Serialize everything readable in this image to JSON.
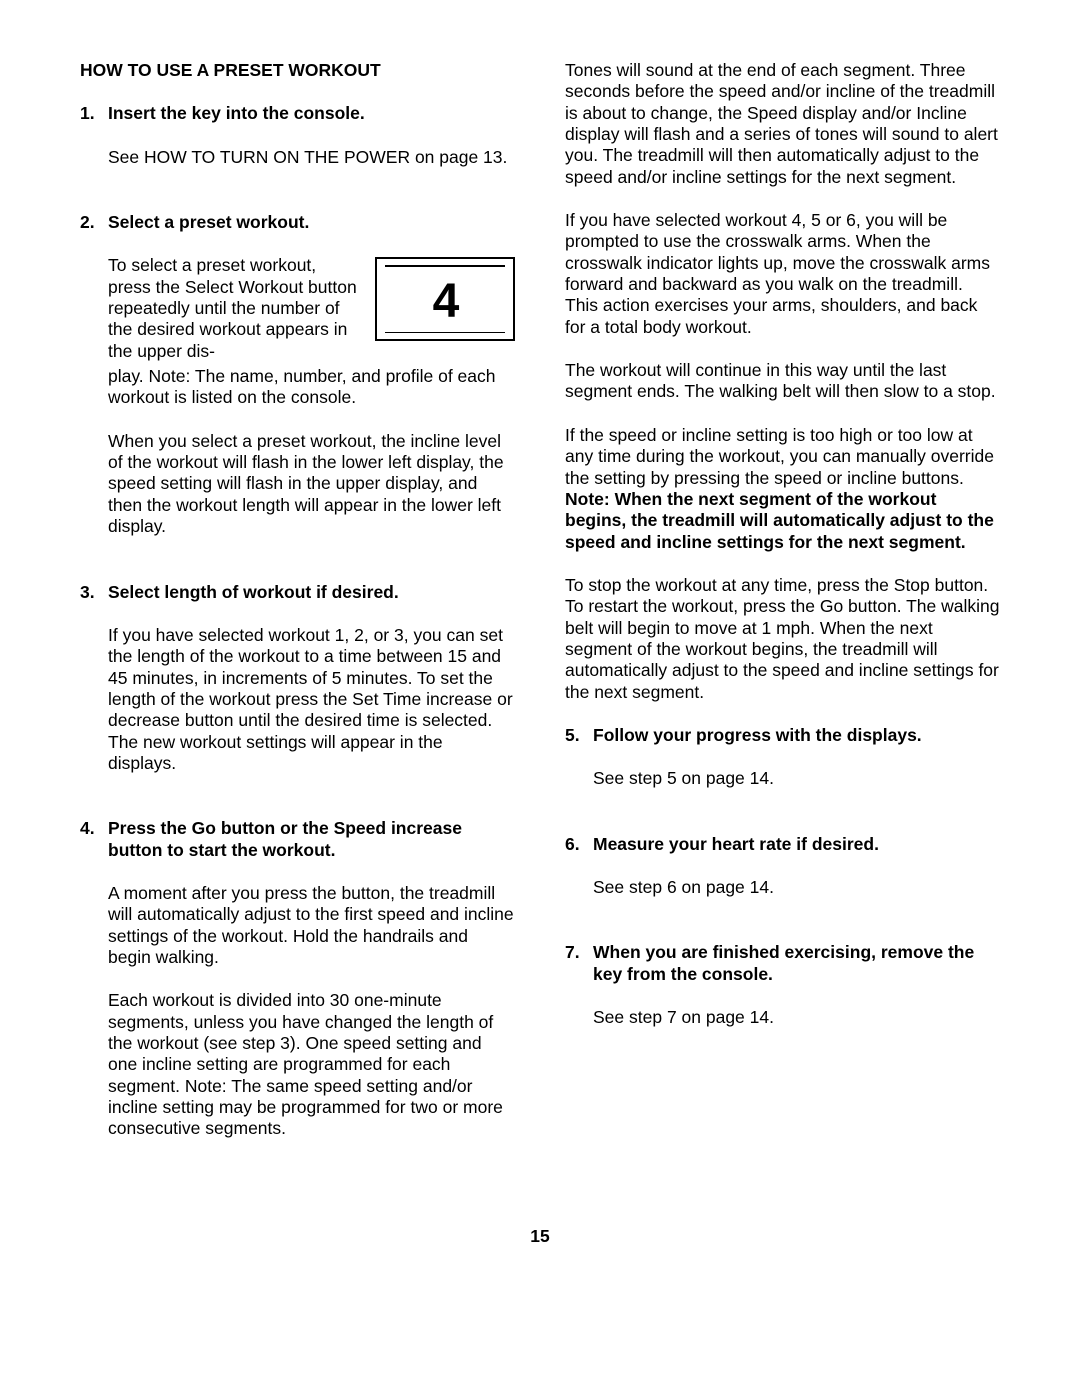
{
  "title": "HOW TO USE A PRESET WORKOUT",
  "steps_left": [
    {
      "num": "1.",
      "heading": "Insert the key into the console.",
      "paras": [
        "See HOW TO TURN ON THE POWER on page 13."
      ]
    },
    {
      "num": "2.",
      "heading": "Select a preset workout.",
      "float_text": "To select a preset workout, press the Select Workout button repeatedly until the number of the desired workout appears in the upper dis-",
      "display_digit": "4",
      "continuation": "play. Note: The name, number, and profile of each workout is listed on the console.",
      "paras": [
        "When you select a preset workout, the incline level of the workout will flash in the lower left display, the speed setting will flash in the upper display, and then the workout length will appear in the lower left display."
      ]
    },
    {
      "num": "3.",
      "heading": "Select length of workout if desired.",
      "paras": [
        "If you have selected workout 1, 2, or 3, you can set the length of the workout to a time between 15 and 45 minutes, in increments of 5 minutes. To set the length of the workout press the Set Time increase or decrease button until the desired time is selected. The new workout settings will appear in the displays."
      ]
    },
    {
      "num": "4.",
      "heading": "Press the Go button or the Speed increase button to start the workout.",
      "paras": [
        "A moment after you press the button, the treadmill will automatically adjust to the first speed and incline settings of the workout. Hold the handrails and begin walking.",
        "Each workout is divided into 30 one-minute segments, unless you have changed the length of the workout (see step 3). One speed setting and one incline setting are programmed for each segment. Note: The same speed setting and/or incline setting may be programmed for two or more consecutive segments."
      ]
    }
  ],
  "col2_intro": [
    "Tones will sound at the end of each segment. Three seconds before the speed and/or incline of the treadmill is about to change, the Speed display and/or Incline display will flash and a series of tones will sound to alert you. The treadmill will then automatically adjust to the speed and/or incline settings for the next segment.",
    "If you have selected workout 4, 5 or 6, you will be prompted to use the crosswalk arms. When the crosswalk indicator lights up, move the crosswalk arms forward and backward as you walk on the treadmill. This action exercises your arms, shoulders, and back for a total body workout.",
    "The workout will continue in this way until the last segment ends. The walking belt will then slow to a stop."
  ],
  "col2_override_pre": "If the speed or incline setting is too high or too low at any time during the workout, you can manually override the setting by pressing the speed or incline buttons. ",
  "col2_override_bold": "Note: When the next segment of the workout begins, the treadmill will automatically adjust to the speed and incline settings for the next segment.",
  "col2_stop": "To stop the workout at any time, press the Stop button. To restart the workout, press the Go button. The walking belt will begin to move at 1 mph. When the next segment of the workout begins, the treadmill will automatically adjust to the speed and incline settings for the next segment.",
  "steps_right": [
    {
      "num": "5.",
      "heading": "Follow your progress with the displays.",
      "para": "See step 5 on page 14."
    },
    {
      "num": "6.",
      "heading": "Measure your heart rate if desired.",
      "para": "See step 6 on page 14."
    },
    {
      "num": "7.",
      "heading": "When you are finished exercising, remove the key from the console.",
      "para": "See step 7 on page 14."
    }
  ],
  "page_number": "15"
}
